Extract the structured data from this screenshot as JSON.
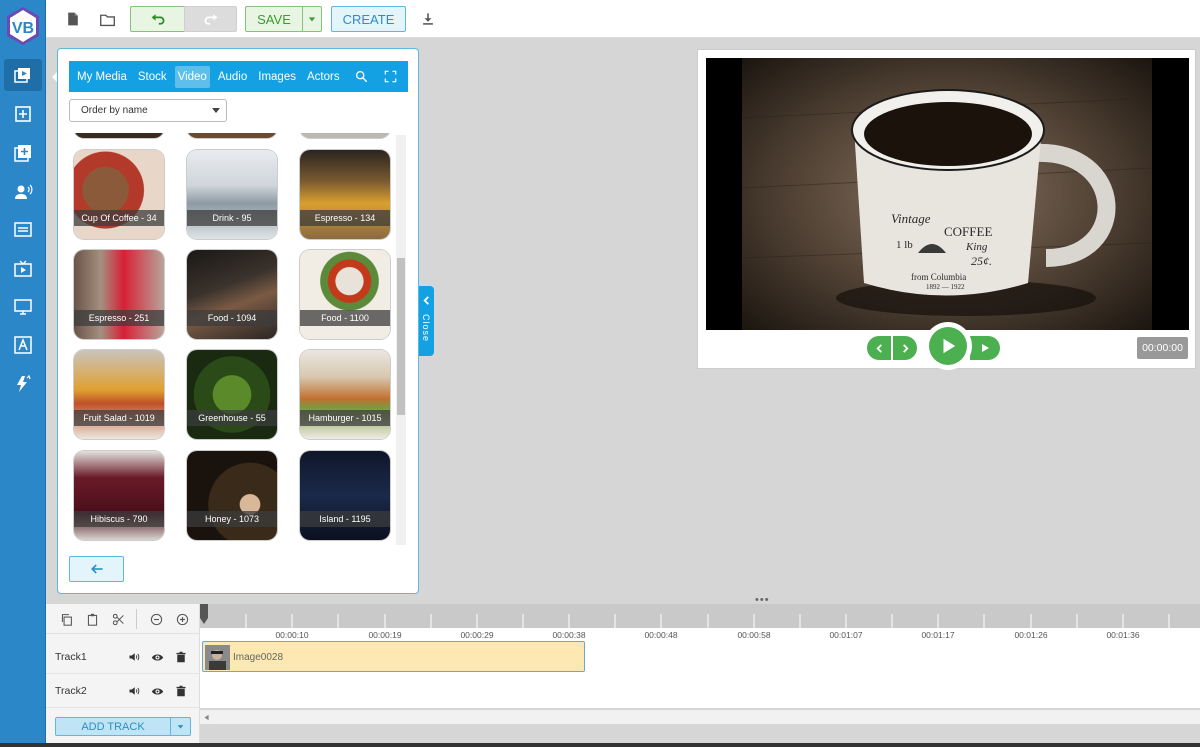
{
  "app": {
    "logo_text": "VB"
  },
  "toolbar": {
    "save_label": "SAVE",
    "create_label": "CREATE"
  },
  "media_panel": {
    "tabs": [
      "My Media",
      "Stock",
      "Video",
      "Audio",
      "Images",
      "Actors"
    ],
    "active_tab": "Video",
    "order_select": "Order by name",
    "close_label": "Close",
    "items": [
      {
        "label": "Cup Of Coffee - 34"
      },
      {
        "label": "Drink - 95"
      },
      {
        "label": "Espresso - 134"
      },
      {
        "label": "Espresso - 251"
      },
      {
        "label": "Food - 1094"
      },
      {
        "label": "Food - 1100"
      },
      {
        "label": "Fruit Salad - 1019"
      },
      {
        "label": "Greenhouse - 55"
      },
      {
        "label": "Hamburger - 1015"
      },
      {
        "label": "Hibiscus - 790"
      },
      {
        "label": "Honey - 1073"
      },
      {
        "label": "Island - 1195"
      }
    ]
  },
  "preview": {
    "timecode": "00:00:00",
    "mug_text": {
      "line1": "Vintage",
      "line2": "COFFEE",
      "line3": "1 lb",
      "line4": "King",
      "line5": "25¢.",
      "line6": "from Columbia",
      "line7": "1892 — 1922"
    }
  },
  "timeline": {
    "ticks": [
      "00:00:10",
      "00:00:19",
      "00:00:29",
      "00:00:38",
      "00:00:48",
      "00:00:58",
      "00:01:07",
      "00:01:17",
      "00:01:26",
      "00:01:36"
    ],
    "tracks": [
      {
        "name": "Track1",
        "clip": "Image0028"
      },
      {
        "name": "Track2",
        "clip": ""
      }
    ],
    "add_track_label": "ADD TRACK",
    "drag_handle": "•••"
  },
  "colors": {
    "sidebar": "#2b87c8",
    "accent": "#13a1e3",
    "green": "#4caf50"
  }
}
